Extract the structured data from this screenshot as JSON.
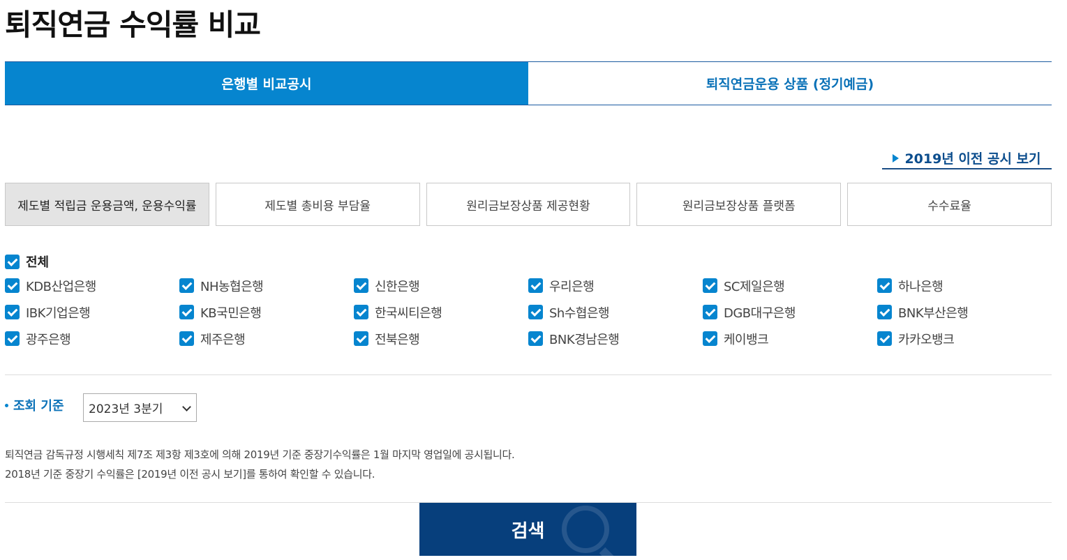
{
  "page": {
    "title": "퇴직연금 수익률 비교"
  },
  "main_tabs": [
    {
      "label": "은행별 비교공시",
      "active": true
    },
    {
      "label": "퇴직연금운용 상품 (정기예금)",
      "active": false
    }
  ],
  "prev_link": {
    "label": "2019년 이전 공시 보기"
  },
  "sub_tabs": [
    {
      "label": "제도별 적립금 운용금액, 운용수익률",
      "active": true
    },
    {
      "label": "제도별 총비용 부담율",
      "active": false
    },
    {
      "label": "원리금보장상품 제공현황",
      "active": false
    },
    {
      "label": "원리금보장상품 플랫폼",
      "active": false
    },
    {
      "label": "수수료율",
      "active": false
    }
  ],
  "check_all": {
    "label": "전체",
    "checked": true
  },
  "banks": [
    "KDB산업은행",
    "NH농협은행",
    "신한은행",
    "우리은행",
    "SC제일은행",
    "하나은행",
    "IBK기업은행",
    "KB국민은행",
    "한국씨티은행",
    "Sh수협은행",
    "DGB대구은행",
    "BNK부산은행",
    "광주은행",
    "제주은행",
    "전북은행",
    "BNK경남은행",
    "케이뱅크",
    "카카오뱅크"
  ],
  "query": {
    "label": "조회 기준",
    "selected": "2023년 3분기"
  },
  "notice": [
    "퇴직연금 감독규정 시행세칙 제7조 제3항 제3호에 의해 2019년 기준 중장기수익률은 1월 마지막 영업일에 공시됩니다.",
    "2018년 기준 중장기 수익률은 [2019년 이전 공시 보기]를 통하여 확인할 수 있습니다."
  ],
  "search_button": {
    "label": "검색"
  },
  "colors": {
    "primary": "#0685cf",
    "dark": "#073f7c"
  }
}
